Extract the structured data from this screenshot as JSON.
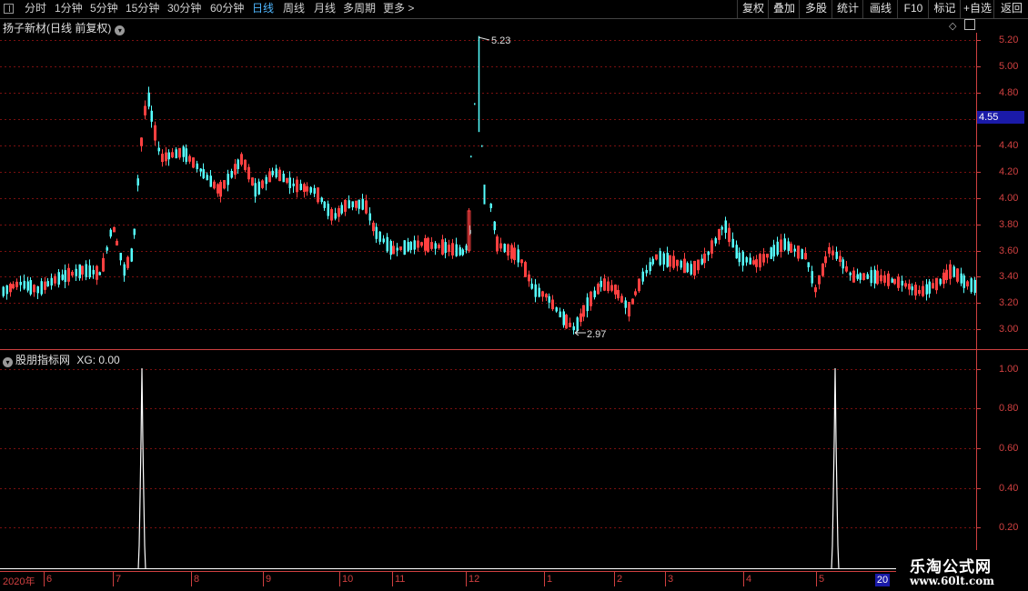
{
  "toolbar": {
    "periods": [
      "分时",
      "1分钟",
      "5分钟",
      "15分钟",
      "30分钟",
      "60分钟",
      "日线",
      "周线",
      "月线",
      "多周期",
      "更多"
    ],
    "active_period": "日线",
    "more_arrow": ">",
    "right_buttons": [
      "复权",
      "叠加",
      "多股",
      "统计",
      "画线",
      "F10",
      "标记",
      "+自选",
      "返回"
    ]
  },
  "main_panel": {
    "title": "扬子新材(日线 前复权)",
    "current_price": "4.55",
    "high_label": "5.23",
    "low_label": "2.97",
    "price_axis": [
      "5.20",
      "5.00",
      "4.80",
      "4.60",
      "4.40",
      "4.20",
      "4.00",
      "3.80",
      "3.60",
      "3.40",
      "3.20",
      "3.00"
    ],
    "colors": {
      "up": "#ff4040",
      "down": "#55ffff",
      "grid": "#7a1010",
      "axis": "#d04040",
      "tag_bg": "#1a1aa8"
    }
  },
  "indicator_panel": {
    "title": "股朋指标网",
    "xg_label": "XG: 0.00",
    "axis": [
      "1.00",
      "0.80",
      "0.60",
      "0.40",
      "0.20"
    ]
  },
  "date_axis": {
    "labels": [
      "2020年",
      "6",
      "7",
      "8",
      "9",
      "10",
      "11",
      "12",
      "1",
      "2",
      "3",
      "4",
      "5",
      "20"
    ]
  },
  "watermark": {
    "line1": "乐淘公式网",
    "line2": "www.60lt.com"
  },
  "chart_data": {
    "type": "candlestick",
    "price_range": [
      2.9,
      5.3
    ],
    "high": 5.23,
    "low": 2.97,
    "last": 4.55,
    "indicator": {
      "name": "XG",
      "value": 0.0,
      "range": [
        0,
        1.0
      ],
      "signals": 2
    }
  }
}
